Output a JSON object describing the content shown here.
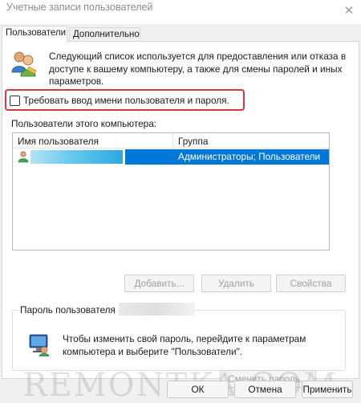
{
  "window": {
    "title": "Учетные записи пользователей",
    "close_glyph": "✕"
  },
  "tabs": [
    {
      "label": "Пользователи",
      "active": true
    },
    {
      "label": "Дополнительно",
      "active": false
    }
  ],
  "intro": {
    "icon": "users-icon",
    "text": "Следующий список используется для предоставления или отказа в доступе к вашему компьютеру, а также для смены паролей и иных параметров."
  },
  "require_login": {
    "label": "Требовать ввод имени пользователя и пароля.",
    "checked": false,
    "highlight_color": "#d9383a"
  },
  "users_section": {
    "label": "Пользователи этого компьютера:",
    "columns": [
      "Имя пользователя",
      "Группа"
    ],
    "rows": [
      {
        "name_redacted": true,
        "group": "Администраторы; Пользователи",
        "selected": true
      }
    ],
    "selection_color": "#0078d7"
  },
  "list_buttons": {
    "add": "Добавить...",
    "remove": "Удалить",
    "properties": "Свойства"
  },
  "password_group": {
    "title": "Пароль пользователя",
    "icon": "computer-icon",
    "text": "Чтобы изменить свой пароль, перейдите к параметрам компьютера и выберите \"Пользователи\".",
    "change_button": "Сменить пароль..."
  },
  "watermark": "REMONTKA.COM",
  "dialog_buttons": {
    "ok": "ОК",
    "cancel": "Отмена",
    "apply": "Применить"
  }
}
